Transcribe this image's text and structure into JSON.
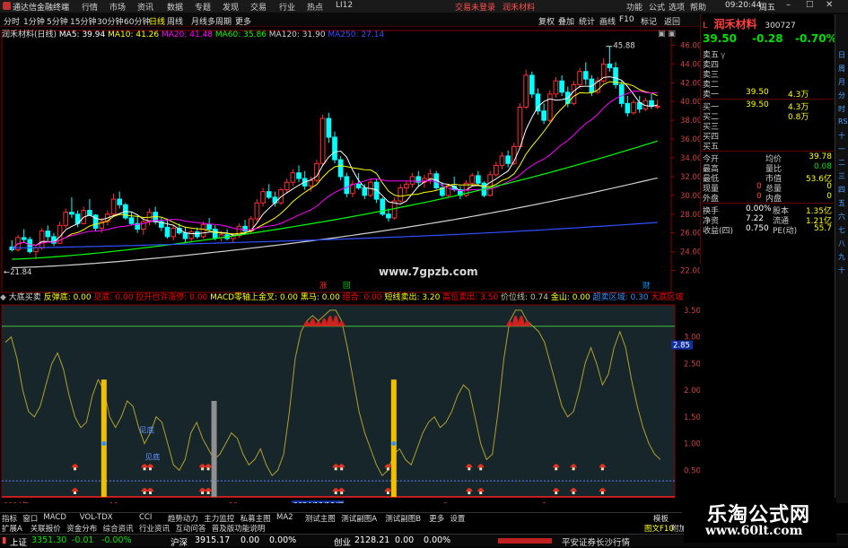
{
  "titlebar": {
    "app_name": "通达信金融终端",
    "menu": [
      "行情",
      "市场",
      "资讯",
      "数据",
      "专题",
      "发现",
      "交易",
      "行业",
      "热点",
      "LI12"
    ],
    "notice_red": "交易未登录",
    "stock_name_red": "润禾材料",
    "right_menu": [
      "功能",
      "公式",
      "选项",
      "帮助"
    ],
    "time": "09:20:44",
    "weekday": "周五"
  },
  "toolbar": {
    "timeframes": [
      "分时",
      "1分钟",
      "5分钟",
      "15分钟",
      "30分钟",
      "60分钟",
      "日线",
      "周线",
      "月线",
      "多周期",
      "更多"
    ],
    "active_timeframe": "日线",
    "right_tools": [
      "复权",
      "叠加",
      "统计",
      "画线",
      "F10",
      "标记",
      "返回"
    ]
  },
  "main_chart_header": {
    "stock": "润禾材料(日线)",
    "ma": [
      {
        "label": "MA5: 39.94",
        "color": "#ffffff"
      },
      {
        "label": "MA10: 41.26",
        "color": "#ffff00"
      },
      {
        "label": "MA20: 41.48",
        "color": "#ff00ff"
      },
      {
        "label": "MA60: 35.86",
        "color": "#00ff00"
      },
      {
        "label": "MA120: 31.90",
        "color": "#d0d0d0"
      },
      {
        "label": "MA250: 27.14",
        "color": "#3050ff"
      }
    ]
  },
  "main_chart": {
    "y_ticks": [
      "46.00",
      "44.00",
      "42.00",
      "40.00",
      "38.00",
      "36.00",
      "34.00",
      "32.00",
      "30.00",
      "28.00",
      "26.00",
      "24.00",
      "22.00"
    ],
    "high_marker": "45.88",
    "low_marker": "21.84",
    "watermark_site": "www.7gpzb.com",
    "marks": [
      "涨",
      "回",
      "财"
    ]
  },
  "indicator_header": {
    "name": "大底买卖",
    "items": [
      {
        "label": "反弹底: 0.00",
        "color": "#ffff00"
      },
      {
        "label": "见底: 0.00",
        "color": "#ff0000"
      },
      {
        "label": "拉升也许涨停: 0.00",
        "color": "#ff0000"
      },
      {
        "label": "MACD零轴上金叉: 0.00",
        "color": "#ffff00"
      },
      {
        "label": "黑马: 0.00",
        "color": "#ffff00"
      },
      {
        "label": "组合: 0.00",
        "color": "#ff0000"
      },
      {
        "label": "短线卖出: 3.20",
        "color": "#ffff00"
      },
      {
        "label": "高位卖出: 3.50",
        "color": "#ff0000"
      },
      {
        "label": "价位线: 0.74",
        "color": "#c8c8a0"
      },
      {
        "label": "金山: 0.00",
        "color": "#ffff00"
      },
      {
        "label": "超卖区域: 0.30",
        "color": "#3090ff"
      },
      {
        "label": "大底区域",
        "color": "#ff0000"
      }
    ]
  },
  "sub_chart": {
    "y_ticks": [
      "3.50",
      "3.00",
      "2.85",
      "2.50",
      "2.00",
      "1.50",
      "1.00",
      "0.50"
    ],
    "current_value": "2.85",
    "labels": [
      "见底",
      "见底"
    ],
    "dates": [
      "2024年",
      "11",
      "12",
      "2024/12/18/三",
      "2",
      "3"
    ]
  },
  "tabs_row1": [
    "指标",
    "窗口",
    "MACD",
    "VOL-TDX",
    "CCI",
    "趋势动力",
    "主力监控",
    "私募主图",
    "MA2",
    "测试主图",
    "测试副图A",
    "测试副图B",
    "更多",
    "设置"
  ],
  "tabs_row2": [
    "扩展A",
    "关联报价",
    "资金分布",
    "综合资讯",
    "行业资讯",
    "互动问答",
    "普及版功能说明"
  ],
  "tabs_row1_right": "模板",
  "tabs_row2_right": "图文F10",
  "tabs_row2_far": "附加",
  "quote_panel": {
    "name": "润禾材料",
    "code": "300727",
    "prefix": "L",
    "price": "39.50",
    "change": "-0.28",
    "pct": "-0.70%",
    "asks": [
      {
        "label": "卖五",
        "price": "",
        "vol": "",
        "suffix": "γ"
      },
      {
        "label": "卖四",
        "price": "",
        "vol": ""
      },
      {
        "label": "卖三",
        "price": "",
        "vol": ""
      },
      {
        "label": "卖二",
        "price": "",
        "vol": ""
      },
      {
        "label": "卖一",
        "price": "39.50",
        "vol": "4.3万"
      }
    ],
    "bids": [
      {
        "label": "买一",
        "price": "39.50",
        "vol": "4.3万"
      },
      {
        "label": "买二",
        "price": "",
        "vol": "0.8万"
      },
      {
        "label": "买三",
        "price": "",
        "vol": ""
      },
      {
        "label": "买四",
        "price": "",
        "vol": ""
      },
      {
        "label": "买五",
        "price": "",
        "vol": ""
      }
    ],
    "stats": [
      {
        "l1": "今开",
        "v1": "",
        "l2": "均价",
        "v2": "39.78"
      },
      {
        "l1": "最高",
        "v1": "",
        "l2": "量比",
        "v2": "0.08"
      },
      {
        "l1": "最低",
        "v1": "",
        "l2": "市值",
        "v2": "53.6亿"
      },
      {
        "l1": "现量",
        "v1": "0",
        "l2": "总量",
        "v2": "0"
      },
      {
        "l1": "外盘",
        "v1": "0",
        "l2": "内盘",
        "v2": "0"
      }
    ],
    "stats2": [
      {
        "l1": "换手",
        "v1": "0.00%",
        "l2": "股本",
        "v2": "1.35亿"
      },
      {
        "l1": "净资",
        "v1": "7.22",
        "l2": "流通",
        "v2": "1.21亿"
      },
      {
        "l1": "收益(四)",
        "v1": "0.750",
        "l2": "PE(动)",
        "v2": "55.7"
      }
    ]
  },
  "right_sidebar": [
    "日",
    "周",
    "月",
    "分",
    "时",
    "RSI",
    "十",
    "一",
    "二",
    "三",
    "四",
    "五",
    "六",
    "七",
    "八",
    "九",
    "十"
  ],
  "statusbar": {
    "sh_label": "上证",
    "sh_value": "3351.30",
    "sh_chg": "-0.01",
    "sh_pct": "-0.00%",
    "sz_label": "沪深",
    "sz_value": "3915.17",
    "sz_chg": "0.00",
    "sz_pct": "0.00%",
    "cy_label": "创业",
    "cy_value": "2128.21",
    "cy_chg": "0.00",
    "cy_pct": "0.00%",
    "broker": "平安证券长沙行情"
  },
  "watermark": {
    "line1": "乐淘公式网",
    "line2": "www.60lt.com"
  },
  "chart_data": [
    {
      "type": "candlestick",
      "title": "润禾材料(日线)",
      "y_range": [
        21,
        47
      ],
      "high": 45.88,
      "low": 21.84,
      "ohlc": [
        [
          24.5,
          25.2,
          24.0,
          24.2
        ],
        [
          24.2,
          25.8,
          24.0,
          25.5
        ],
        [
          25.5,
          26.4,
          25.0,
          25.3
        ],
        [
          25.3,
          25.6,
          23.8,
          24.0
        ],
        [
          24.0,
          24.6,
          23.2,
          24.4
        ],
        [
          24.4,
          26.5,
          24.2,
          26.2
        ],
        [
          26.2,
          26.8,
          25.2,
          25.6
        ],
        [
          25.6,
          26.0,
          24.6,
          24.9
        ],
        [
          24.9,
          27.2,
          24.8,
          26.8
        ],
        [
          26.8,
          28.6,
          26.5,
          28.2
        ],
        [
          28.2,
          29.8,
          27.6,
          28.0
        ],
        [
          28.0,
          28.4,
          26.6,
          27.0
        ],
        [
          27.0,
          28.8,
          26.9,
          28.4
        ],
        [
          28.4,
          29.6,
          27.8,
          27.9
        ],
        [
          27.9,
          28.0,
          26.2,
          26.5
        ],
        [
          26.5,
          27.6,
          26.0,
          27.2
        ],
        [
          27.2,
          28.4,
          26.8,
          28.0
        ],
        [
          28.0,
          30.2,
          27.8,
          29.6
        ],
        [
          29.6,
          30.4,
          28.6,
          29.0
        ],
        [
          29.0,
          29.2,
          27.4,
          27.6
        ],
        [
          27.6,
          28.2,
          26.8,
          27.0
        ],
        [
          27.0,
          27.8,
          26.0,
          26.4
        ],
        [
          26.4,
          27.6,
          25.8,
          27.2
        ],
        [
          27.2,
          28.6,
          26.8,
          28.2
        ],
        [
          28.2,
          28.8,
          26.9,
          27.2
        ],
        [
          27.2,
          27.6,
          26.2,
          26.6
        ],
        [
          26.6,
          27.4,
          25.4,
          25.6
        ],
        [
          25.6,
          26.8,
          25.2,
          26.5
        ],
        [
          26.5,
          27.0,
          25.8,
          26.0
        ],
        [
          26.0,
          26.6,
          25.0,
          25.4
        ],
        [
          25.4,
          26.4,
          25.0,
          26.1
        ],
        [
          26.1,
          26.6,
          25.4,
          25.6
        ],
        [
          25.6,
          27.2,
          25.4,
          26.9
        ],
        [
          26.9,
          27.6,
          26.2,
          26.4
        ],
        [
          26.4,
          26.8,
          25.2,
          25.5
        ],
        [
          25.5,
          26.2,
          25.1,
          25.8
        ],
        [
          25.8,
          26.4,
          25.2,
          25.4
        ],
        [
          25.4,
          26.0,
          24.9,
          25.7
        ],
        [
          25.7,
          27.0,
          25.5,
          26.7
        ],
        [
          26.7,
          27.4,
          26.0,
          26.2
        ],
        [
          26.2,
          27.8,
          26.0,
          27.5
        ],
        [
          27.5,
          29.6,
          27.2,
          29.2
        ],
        [
          29.2,
          30.8,
          28.8,
          30.4
        ],
        [
          30.4,
          31.2,
          29.6,
          29.8
        ],
        [
          29.8,
          30.4,
          28.8,
          29.2
        ],
        [
          29.2,
          30.8,
          29.0,
          30.6
        ],
        [
          30.6,
          31.8,
          30.2,
          31.4
        ],
        [
          31.4,
          32.8,
          31.0,
          32.4
        ],
        [
          32.4,
          33.2,
          31.4,
          31.8
        ],
        [
          31.8,
          32.6,
          30.6,
          31.0
        ],
        [
          31.0,
          32.0,
          30.4,
          31.6
        ],
        [
          31.6,
          33.8,
          31.4,
          33.4
        ],
        [
          33.4,
          38.6,
          33.2,
          38.2
        ],
        [
          38.2,
          38.8,
          35.6,
          36.2
        ],
        [
          36.2,
          36.8,
          33.4,
          33.8
        ],
        [
          33.8,
          34.2,
          31.6,
          32.0
        ],
        [
          32.0,
          32.4,
          29.8,
          30.2
        ],
        [
          30.2,
          31.6,
          29.8,
          31.2
        ],
        [
          31.2,
          32.4,
          30.6,
          30.8
        ],
        [
          30.8,
          31.2,
          29.6,
          30.0
        ],
        [
          30.0,
          31.8,
          29.8,
          31.4
        ],
        [
          31.4,
          31.8,
          29.2,
          29.6
        ],
        [
          29.6,
          29.8,
          27.8,
          28.0
        ],
        [
          28.0,
          28.6,
          27.2,
          27.6
        ],
        [
          27.6,
          29.8,
          27.4,
          29.4
        ],
        [
          29.4,
          31.2,
          29.2,
          30.8
        ],
        [
          30.8,
          31.6,
          30.2,
          31.2
        ],
        [
          31.2,
          32.4,
          30.8,
          32.0
        ],
        [
          32.0,
          32.6,
          30.9,
          31.4
        ],
        [
          31.4,
          32.2,
          30.8,
          31.8
        ],
        [
          31.8,
          32.8,
          31.2,
          32.3
        ],
        [
          32.3,
          32.6,
          30.6,
          30.8
        ],
        [
          30.8,
          31.4,
          29.8,
          30.0
        ],
        [
          30.0,
          31.2,
          29.8,
          31.0
        ],
        [
          31.0,
          32.0,
          30.4,
          30.6
        ],
        [
          30.6,
          31.0,
          29.6,
          30.0
        ],
        [
          30.0,
          31.6,
          29.8,
          31.3
        ],
        [
          31.3,
          32.4,
          31.0,
          32.1
        ],
        [
          32.1,
          32.6,
          31.0,
          31.3
        ],
        [
          31.3,
          31.5,
          29.8,
          30.0
        ],
        [
          30.0,
          32.6,
          29.9,
          32.2
        ],
        [
          32.2,
          33.6,
          32.0,
          33.2
        ],
        [
          33.2,
          34.6,
          32.8,
          34.2
        ],
        [
          34.2,
          34.8,
          33.0,
          33.4
        ],
        [
          33.4,
          35.6,
          33.2,
          35.2
        ],
        [
          35.2,
          39.8,
          35.0,
          39.4
        ],
        [
          39.4,
          43.4,
          39.2,
          42.8
        ],
        [
          42.8,
          43.2,
          40.4,
          40.8
        ],
        [
          40.8,
          41.4,
          38.6,
          39.0
        ],
        [
          39.0,
          39.8,
          37.6,
          38.0
        ],
        [
          38.0,
          41.2,
          37.8,
          40.8
        ],
        [
          40.8,
          42.6,
          40.4,
          42.2
        ],
        [
          42.2,
          42.8,
          40.6,
          41.0
        ],
        [
          41.0,
          41.6,
          39.4,
          39.8
        ],
        [
          39.8,
          42.2,
          39.6,
          41.8
        ],
        [
          41.8,
          43.6,
          41.4,
          43.2
        ],
        [
          43.2,
          44.2,
          41.8,
          42.4
        ],
        [
          42.4,
          42.8,
          40.6,
          41.0
        ],
        [
          41.0,
          42.6,
          40.8,
          42.2
        ],
        [
          42.2,
          44.6,
          42.0,
          44.0
        ],
        [
          44.0,
          45.88,
          43.2,
          43.6
        ],
        [
          43.6,
          44.2,
          41.4,
          41.8
        ],
        [
          41.8,
          42.2,
          39.4,
          39.8
        ],
        [
          39.8,
          40.6,
          38.4,
          38.8
        ],
        [
          38.8,
          40.2,
          38.6,
          39.9
        ],
        [
          39.9,
          40.6,
          38.8,
          39.2
        ],
        [
          39.2,
          40.4,
          39.0,
          40.1
        ],
        [
          40.1,
          40.8,
          39.2,
          39.5
        ],
        [
          39.5,
          40.2,
          39.2,
          39.5
        ]
      ],
      "series": [
        {
          "name": "MA5",
          "color": "#ffffff",
          "last": 39.94
        },
        {
          "name": "MA10",
          "color": "#ffff00",
          "last": 41.26
        },
        {
          "name": "MA20",
          "color": "#ff00ff",
          "last": 41.48
        },
        {
          "name": "MA60",
          "color": "#00ff00",
          "last": 35.86
        },
        {
          "name": "MA120",
          "color": "#d0d0d0",
          "last": 31.9
        },
        {
          "name": "MA250",
          "color": "#3050ff",
          "last": 27.14
        }
      ]
    },
    {
      "type": "line",
      "title": "大底买卖",
      "y_range": [
        0,
        3.6
      ],
      "reference_lines": [
        3.2,
        0.3,
        0.0
      ],
      "values": [
        2.9,
        3.0,
        2.6,
        2.0,
        1.6,
        1.5,
        1.7,
        2.1,
        2.5,
        2.7,
        2.4,
        1.9,
        1.5,
        1.3,
        1.4,
        1.9,
        2.2,
        2.0,
        1.5,
        1.3,
        1.5,
        1.8,
        1.7,
        1.3,
        1.0,
        1.2,
        1.5,
        1.4,
        1.0,
        0.6,
        0.5,
        0.7,
        1.2,
        1.4,
        1.1,
        0.9,
        0.7,
        0.8,
        1.0,
        1.2,
        1.1,
        0.8,
        0.6,
        0.7,
        0.9,
        0.6,
        0.4,
        0.5,
        0.8,
        1.6,
        2.6,
        3.1,
        3.3,
        3.4,
        3.3,
        3.4,
        3.5,
        3.5,
        3.3,
        2.8,
        2.2,
        1.6,
        1.2,
        0.9,
        0.6,
        0.4,
        0.5,
        0.8,
        0.9,
        0.7,
        0.6,
        0.9,
        1.2,
        1.4,
        1.5,
        1.3,
        1.4,
        1.6,
        1.9,
        2.1,
        2.0,
        1.5,
        1.0,
        0.7,
        0.8,
        1.6,
        2.6,
        3.3,
        3.5,
        3.5,
        3.3,
        3.2,
        3.1,
        2.9,
        2.5,
        2.1,
        1.7,
        1.5,
        1.6,
        2.0,
        2.5,
        2.8,
        2.5,
        2.1,
        2.3,
        2.8,
        3.1,
        2.8,
        2.2,
        1.7,
        1.3,
        1.0,
        0.8,
        0.7
      ],
      "signals_bottom": [
        12,
        24,
        25,
        34,
        35,
        57,
        58,
        66,
        80,
        82,
        95,
        98,
        103
      ]
    }
  ]
}
